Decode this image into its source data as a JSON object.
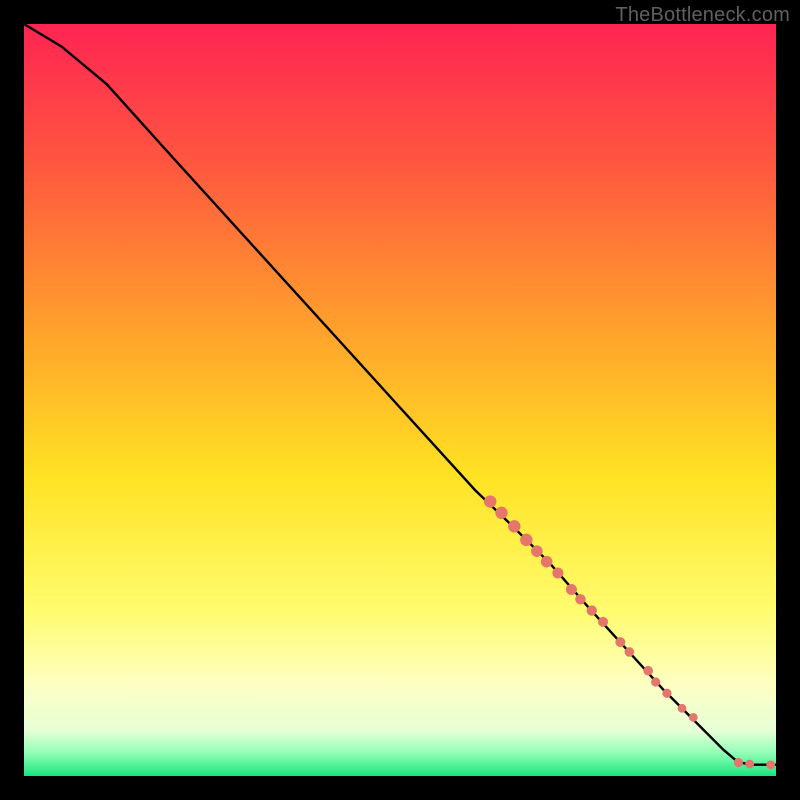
{
  "watermark": "TheBottleneck.com",
  "chart_data": {
    "type": "line",
    "title": "",
    "xlabel": "",
    "ylabel": "",
    "xlim": [
      0,
      100
    ],
    "ylim": [
      0,
      100
    ],
    "grid": false,
    "legend": false,
    "gradient_stops": [
      {
        "offset": 0,
        "color": "#ff2453"
      },
      {
        "offset": 18,
        "color": "#ff5540"
      },
      {
        "offset": 40,
        "color": "#ff9f2c"
      },
      {
        "offset": 60,
        "color": "#ffe223"
      },
      {
        "offset": 78,
        "color": "#fffc6e"
      },
      {
        "offset": 88,
        "color": "#fdffc4"
      },
      {
        "offset": 94,
        "color": "#e6ffd6"
      },
      {
        "offset": 97,
        "color": "#8fffb5"
      },
      {
        "offset": 100,
        "color": "#18e47e"
      }
    ],
    "series": [
      {
        "name": "bottleneck-curve",
        "stroke": "#000000",
        "points": [
          {
            "x": 0,
            "y": 100
          },
          {
            "x": 5,
            "y": 97
          },
          {
            "x": 11,
            "y": 92
          },
          {
            "x": 20,
            "y": 82
          },
          {
            "x": 30,
            "y": 71
          },
          {
            "x": 40,
            "y": 60
          },
          {
            "x": 50,
            "y": 49
          },
          {
            "x": 60,
            "y": 38
          },
          {
            "x": 65,
            "y": 33.2
          },
          {
            "x": 70,
            "y": 28.2
          },
          {
            "x": 75,
            "y": 22.5
          },
          {
            "x": 80,
            "y": 17
          },
          {
            "x": 85,
            "y": 11.5
          },
          {
            "x": 90,
            "y": 6.5
          },
          {
            "x": 93,
            "y": 3.5
          },
          {
            "x": 95,
            "y": 1.8
          },
          {
            "x": 97,
            "y": 1.5
          },
          {
            "x": 100,
            "y": 1.5
          }
        ]
      }
    ],
    "markers": {
      "color": "#e5766c",
      "radius_range": [
        4.2,
        6.2
      ],
      "points": [
        {
          "x": 62.0,
          "y": 36.5,
          "r": 6.2
        },
        {
          "x": 63.5,
          "y": 35.0,
          "r": 6.2
        },
        {
          "x": 65.2,
          "y": 33.2,
          "r": 6.2
        },
        {
          "x": 66.8,
          "y": 31.4,
          "r": 6.2
        },
        {
          "x": 68.2,
          "y": 29.9,
          "r": 5.8
        },
        {
          "x": 69.5,
          "y": 28.5,
          "r": 5.8
        },
        {
          "x": 71.0,
          "y": 27.0,
          "r": 5.5
        },
        {
          "x": 72.8,
          "y": 24.8,
          "r": 5.5
        },
        {
          "x": 74.0,
          "y": 23.5,
          "r": 5.2
        },
        {
          "x": 75.5,
          "y": 22.0,
          "r": 5.2
        },
        {
          "x": 77.0,
          "y": 20.5,
          "r": 5.0
        },
        {
          "x": 79.3,
          "y": 17.8,
          "r": 5.0
        },
        {
          "x": 80.5,
          "y": 16.5,
          "r": 4.8
        },
        {
          "x": 83.0,
          "y": 14.0,
          "r": 4.8
        },
        {
          "x": 84.0,
          "y": 12.5,
          "r": 4.6
        },
        {
          "x": 85.5,
          "y": 11.0,
          "r": 4.6
        },
        {
          "x": 87.5,
          "y": 9.0,
          "r": 4.4
        },
        {
          "x": 89.0,
          "y": 7.8,
          "r": 4.4
        },
        {
          "x": 95.0,
          "y": 1.8,
          "r": 4.6
        },
        {
          "x": 96.5,
          "y": 1.6,
          "r": 4.4
        },
        {
          "x": 99.3,
          "y": 1.5,
          "r": 4.4
        }
      ]
    }
  }
}
